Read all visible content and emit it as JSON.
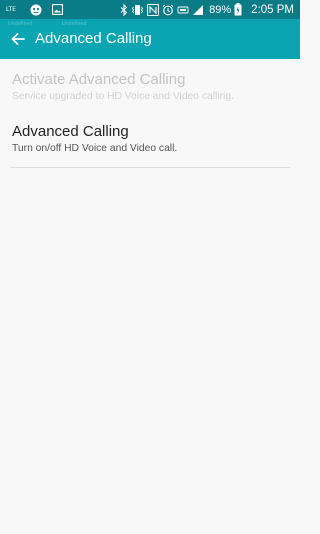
{
  "status_bar": {
    "network_badge": "LTE",
    "battery_percent": "89%",
    "time": "2:05 PM",
    "colors": {
      "background": "#0a7c87",
      "foreground": "#ffffff"
    },
    "icons": [
      "lte-icon",
      "face-notification-icon",
      "image-notification-icon",
      "bluetooth-icon",
      "vibrate-icon",
      "nfc-icon",
      "alarm-icon",
      "volte-icon",
      "signal-icon",
      "battery-charging-icon"
    ]
  },
  "app_bar": {
    "title": "Advanced Calling",
    "background": "#0aa4b2",
    "ghost_left": "Undefined",
    "ghost_right": "Undefined"
  },
  "settings": [
    {
      "title": "Activate Advanced Calling",
      "subtitle": "Service upgraded to HD Voice and Video calling.",
      "enabled": false
    },
    {
      "title": "Advanced Calling",
      "subtitle": "Turn on/off HD Voice and Video call.",
      "enabled": true
    }
  ]
}
